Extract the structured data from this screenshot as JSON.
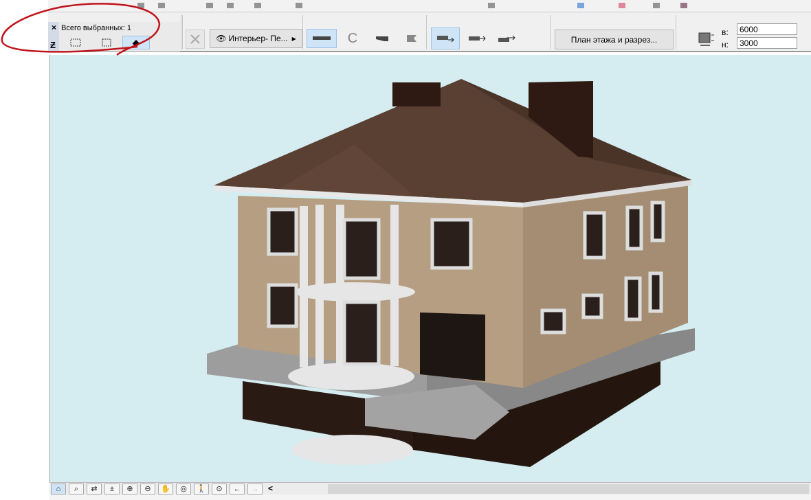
{
  "info_panel": {
    "close": "×",
    "title": "Всего выбранных: 1"
  },
  "toolbar": {
    "view_dropdown": "Интерьер- Пе...",
    "plan_section_button": "План этажа и разрез...",
    "height_label": "в:",
    "height_value": "6000",
    "low_label": "н:",
    "low_value": "3000"
  },
  "bottom_bar": {
    "scroll_left": "<"
  },
  "colors": {
    "canvas": "#d5edf1",
    "annotation": "#c0141c",
    "roof": "#5a4032",
    "brick": "#b59e82"
  }
}
